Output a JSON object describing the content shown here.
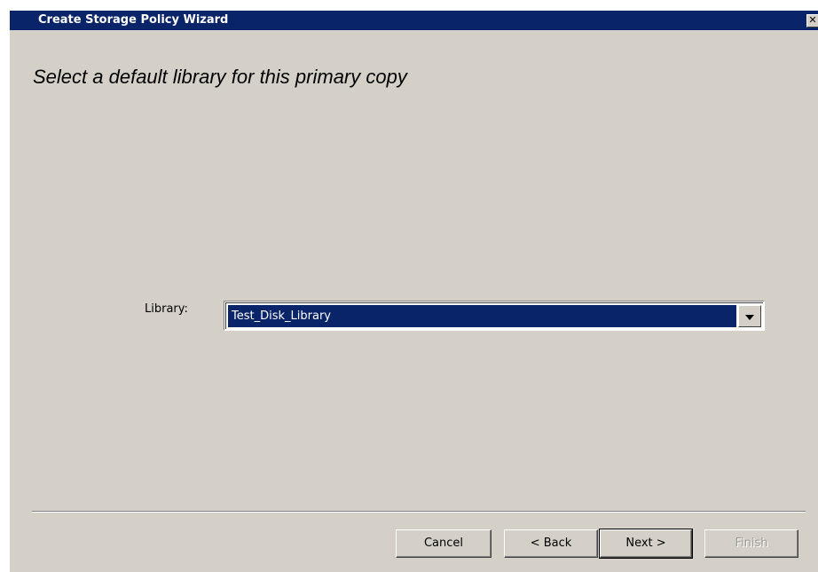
{
  "window": {
    "title": "Create Storage Policy Wizard",
    "close_glyph": "✕"
  },
  "page": {
    "heading": "Select a default library for this primary copy"
  },
  "library": {
    "label": "Library:",
    "selected_value": "Test_Disk_Library"
  },
  "buttons": {
    "cancel": "Cancel",
    "back": "< Back",
    "next": "Next >",
    "finish": "Finish"
  },
  "colors": {
    "titlebar": "#0a246a",
    "face": "#d4d0c8",
    "selection": "#0a246a"
  },
  "icons": {
    "close": "close-icon",
    "dropdown": "chevron-down-icon"
  }
}
